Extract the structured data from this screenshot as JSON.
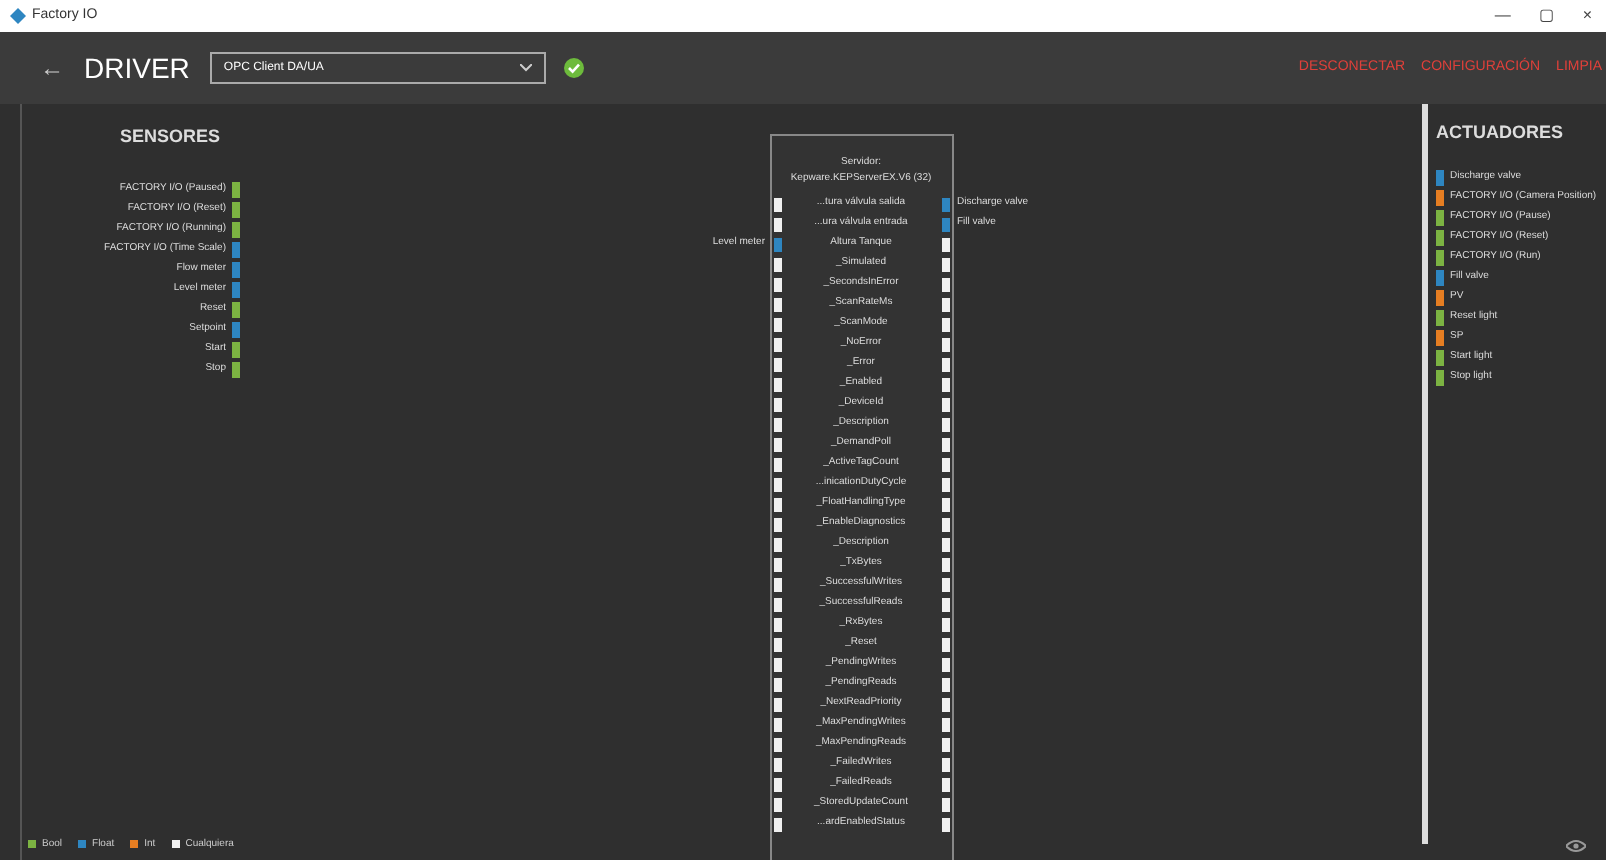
{
  "window": {
    "title": "Factory IO",
    "controls": [
      "—",
      "▢",
      "×"
    ]
  },
  "header": {
    "back": "←",
    "title": "DRIVER",
    "driver_select": {
      "value": "OPC Client DA/UA"
    },
    "connected": true,
    "actions": [
      "DESCONECTAR",
      "CONFIGURACIÓN",
      "LIMPIA"
    ]
  },
  "sensors": {
    "title": "SENSORES",
    "items": [
      {
        "label": "FACTORY I/O (Paused)",
        "color": "#7cb342"
      },
      {
        "label": "FACTORY I/O (Reset)",
        "color": "#7cb342"
      },
      {
        "label": "FACTORY I/O (Running)",
        "color": "#7cb342"
      },
      {
        "label": "FACTORY I/O (Time Scale)",
        "color": "#2e86c1"
      },
      {
        "label": "Flow meter",
        "color": "#2e86c1"
      },
      {
        "label": "Level meter",
        "color": "#2e86c1"
      },
      {
        "label": "Reset",
        "color": "#7cb342"
      },
      {
        "label": "Setpoint",
        "color": "#2e86c1"
      },
      {
        "label": "Start",
        "color": "#7cb342"
      },
      {
        "label": "Stop",
        "color": "#7cb342"
      }
    ]
  },
  "server": {
    "title": "Servidor:",
    "name": "Kepware.KEPServerEX.V6 (32)",
    "rows": [
      {
        "label": "...tura válvula salida",
        "left_port": {
          "color": "#f0f0f0"
        },
        "right_port": {
          "color": "#2e86c1"
        },
        "right_link": "Discharge valve"
      },
      {
        "label": "...ura válvula entrada",
        "left_port": {
          "color": "#f0f0f0"
        },
        "right_port": {
          "color": "#2e86c1"
        },
        "right_link": "Fill valve"
      },
      {
        "label": "Altura Tanque",
        "left_port": {
          "color": "#2e86c1"
        },
        "right_port": {
          "color": "#f0f0f0"
        },
        "left_link": "Level meter"
      },
      {
        "label": "_Simulated",
        "left_port": {
          "color": "#f0f0f0"
        },
        "right_port": {
          "color": "#f0f0f0"
        }
      },
      {
        "label": "_SecondsInError",
        "left_port": {
          "color": "#f0f0f0"
        },
        "right_port": {
          "color": "#f0f0f0"
        }
      },
      {
        "label": "_ScanRateMs",
        "left_port": {
          "color": "#f0f0f0"
        },
        "right_port": {
          "color": "#f0f0f0"
        }
      },
      {
        "label": "_ScanMode",
        "left_port": {
          "color": "#f0f0f0"
        },
        "right_port": {
          "color": "#f0f0f0"
        }
      },
      {
        "label": "_NoError",
        "left_port": {
          "color": "#f0f0f0"
        },
        "right_port": {
          "color": "#f0f0f0"
        }
      },
      {
        "label": "_Error",
        "left_port": {
          "color": "#f0f0f0"
        },
        "right_port": {
          "color": "#f0f0f0"
        }
      },
      {
        "label": "_Enabled",
        "left_port": {
          "color": "#f0f0f0"
        },
        "right_port": {
          "color": "#f0f0f0"
        }
      },
      {
        "label": "_DeviceId",
        "left_port": {
          "color": "#f0f0f0"
        },
        "right_port": {
          "color": "#f0f0f0"
        }
      },
      {
        "label": "_Description",
        "left_port": {
          "color": "#f0f0f0"
        },
        "right_port": {
          "color": "#f0f0f0"
        }
      },
      {
        "label": "_DemandPoll",
        "left_port": {
          "color": "#f0f0f0"
        },
        "right_port": {
          "color": "#f0f0f0"
        }
      },
      {
        "label": "_ActiveTagCount",
        "left_port": {
          "color": "#f0f0f0"
        },
        "right_port": {
          "color": "#f0f0f0"
        }
      },
      {
        "label": "...inicationDutyCycle",
        "left_port": {
          "color": "#f0f0f0"
        },
        "right_port": {
          "color": "#f0f0f0"
        }
      },
      {
        "label": "_FloatHandlingType",
        "left_port": {
          "color": "#f0f0f0"
        },
        "right_port": {
          "color": "#f0f0f0"
        }
      },
      {
        "label": "_EnableDiagnostics",
        "left_port": {
          "color": "#f0f0f0"
        },
        "right_port": {
          "color": "#f0f0f0"
        }
      },
      {
        "label": "_Description",
        "left_port": {
          "color": "#f0f0f0"
        },
        "right_port": {
          "color": "#f0f0f0"
        }
      },
      {
        "label": "_TxBytes",
        "left_port": {
          "color": "#f0f0f0"
        },
        "right_port": {
          "color": "#f0f0f0"
        }
      },
      {
        "label": "_SuccessfulWrites",
        "left_port": {
          "color": "#f0f0f0"
        },
        "right_port": {
          "color": "#f0f0f0"
        }
      },
      {
        "label": "_SuccessfulReads",
        "left_port": {
          "color": "#f0f0f0"
        },
        "right_port": {
          "color": "#f0f0f0"
        }
      },
      {
        "label": "_RxBytes",
        "left_port": {
          "color": "#f0f0f0"
        },
        "right_port": {
          "color": "#f0f0f0"
        }
      },
      {
        "label": "_Reset",
        "left_port": {
          "color": "#f0f0f0"
        },
        "right_port": {
          "color": "#f0f0f0"
        }
      },
      {
        "label": "_PendingWrites",
        "left_port": {
          "color": "#f0f0f0"
        },
        "right_port": {
          "color": "#f0f0f0"
        }
      },
      {
        "label": "_PendingReads",
        "left_port": {
          "color": "#f0f0f0"
        },
        "right_port": {
          "color": "#f0f0f0"
        }
      },
      {
        "label": "_NextReadPriority",
        "left_port": {
          "color": "#f0f0f0"
        },
        "right_port": {
          "color": "#f0f0f0"
        }
      },
      {
        "label": "_MaxPendingWrites",
        "left_port": {
          "color": "#f0f0f0"
        },
        "right_port": {
          "color": "#f0f0f0"
        }
      },
      {
        "label": "_MaxPendingReads",
        "left_port": {
          "color": "#f0f0f0"
        },
        "right_port": {
          "color": "#f0f0f0"
        }
      },
      {
        "label": "_FailedWrites",
        "left_port": {
          "color": "#f0f0f0"
        },
        "right_port": {
          "color": "#f0f0f0"
        }
      },
      {
        "label": "_FailedReads",
        "left_port": {
          "color": "#f0f0f0"
        },
        "right_port": {
          "color": "#f0f0f0"
        }
      },
      {
        "label": "_StoredUpdateCount",
        "left_port": {
          "color": "#f0f0f0"
        },
        "right_port": {
          "color": "#f0f0f0"
        }
      },
      {
        "label": "...ardEnabledStatus",
        "left_port": {
          "color": "#f0f0f0"
        },
        "right_port": {
          "color": "#f0f0f0"
        }
      }
    ]
  },
  "actuators": {
    "title": "ACTUADORES",
    "items": [
      {
        "label": "Discharge valve",
        "color": "#2e86c1"
      },
      {
        "label": "FACTORY I/O (Camera Position)",
        "color": "#e67e22"
      },
      {
        "label": "FACTORY I/O (Pause)",
        "color": "#7cb342"
      },
      {
        "label": "FACTORY I/O (Reset)",
        "color": "#7cb342"
      },
      {
        "label": "FACTORY I/O (Run)",
        "color": "#7cb342"
      },
      {
        "label": "Fill valve",
        "color": "#2e86c1"
      },
      {
        "label": "PV",
        "color": "#e67e22"
      },
      {
        "label": "Reset light",
        "color": "#7cb342"
      },
      {
        "label": "SP",
        "color": "#e67e22"
      },
      {
        "label": "Start light",
        "color": "#7cb342"
      },
      {
        "label": "Stop light",
        "color": "#7cb342"
      }
    ]
  },
  "legend": [
    {
      "label": "Bool",
      "color": "#7cb342"
    },
    {
      "label": "Float",
      "color": "#2e86c1"
    },
    {
      "label": "Int",
      "color": "#e67e22"
    },
    {
      "label": "Cualquiera",
      "color": "#f0f0f0"
    }
  ]
}
